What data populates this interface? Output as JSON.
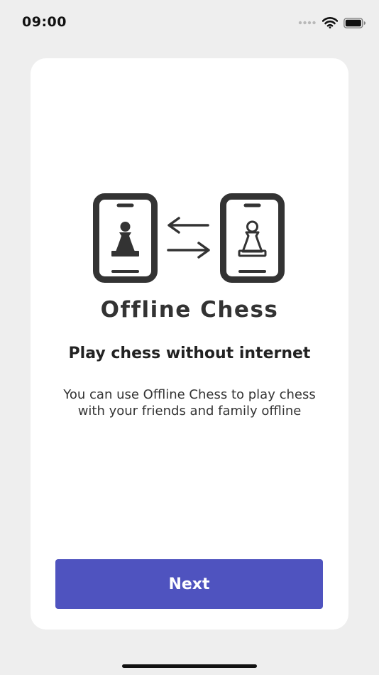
{
  "status_bar": {
    "time": "09:00",
    "icons": [
      "signal-dots-icon",
      "wifi-icon",
      "battery-icon"
    ]
  },
  "onboarding": {
    "app_name": "Offline Chess",
    "headline": "Play chess without internet",
    "description": "You can use Offline Chess to play chess with your friends and family offline",
    "next_label": "Next",
    "hero_icons": [
      "phone-black-pawn-icon",
      "swap-arrows-icon",
      "phone-white-pawn-icon"
    ]
  },
  "colors": {
    "background": "#eeeeee",
    "card": "#ffffff",
    "accent": "#4f53bf",
    "icon": "#333333"
  }
}
